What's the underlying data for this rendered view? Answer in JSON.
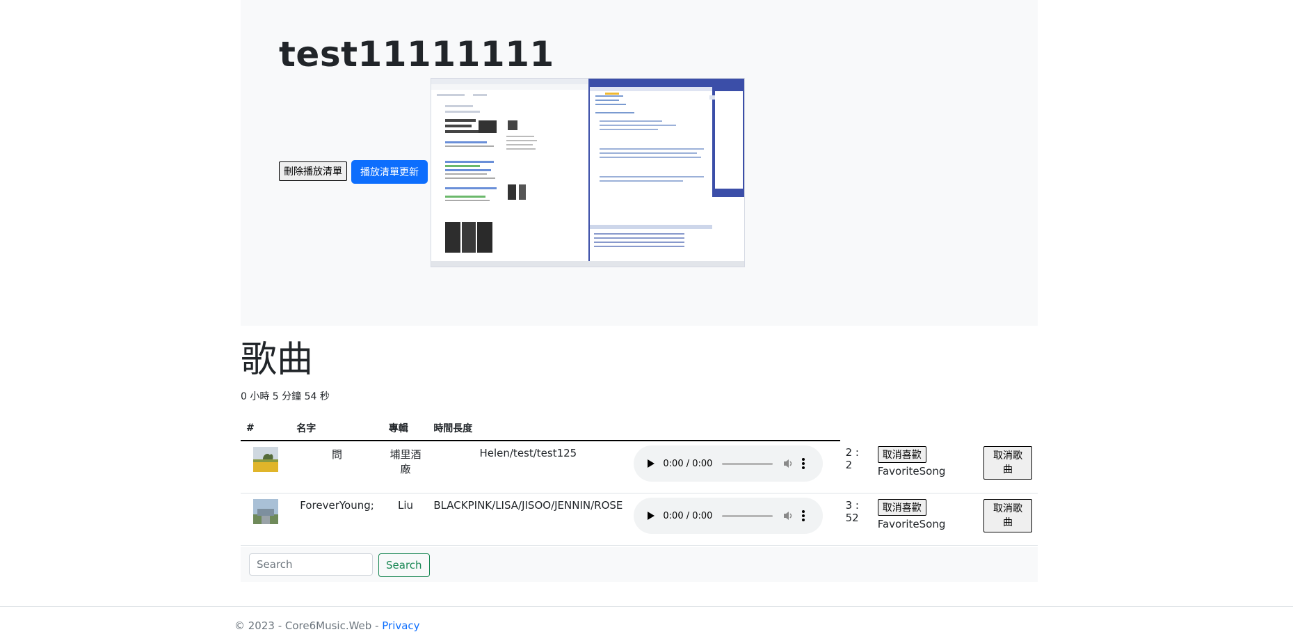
{
  "playlist": {
    "title": "test11111111",
    "delete_button": "刪除播放清單",
    "update_button": "播放清單更新"
  },
  "songs_section": {
    "title": "歌曲",
    "total_duration": "0 小時 5 分鐘 54 秒",
    "columns": [
      "#",
      "名字",
      "專輯",
      "時間長度"
    ],
    "rows": [
      {
        "name": "問",
        "album": "埔里酒廠",
        "artist": "Helen/test/test125",
        "player_time": "0:00 / 0:00",
        "duration": "2 : 2",
        "fav_button": "取消喜歡",
        "fav_label": "FavoriteSong",
        "remove_button": "取消歌曲"
      },
      {
        "name": "ForeverYoung;",
        "album": "Liu",
        "artist": "BLACKPINK/LISA/JISOO/JENNIN/ROSE",
        "player_time": "0:00 / 0:00",
        "duration": "3 : 52",
        "fav_button": "取消喜歡",
        "fav_label": "FavoriteSong",
        "remove_button": "取消歌曲"
      }
    ]
  },
  "search": {
    "placeholder": "Search",
    "button": "Search"
  },
  "footer": {
    "text": "© 2023 - Core6Music.Web - ",
    "privacy_link": "Privacy"
  },
  "colors": {
    "primary": "#0d6efd",
    "success": "#198754",
    "light_bg": "#f8f9fa"
  }
}
